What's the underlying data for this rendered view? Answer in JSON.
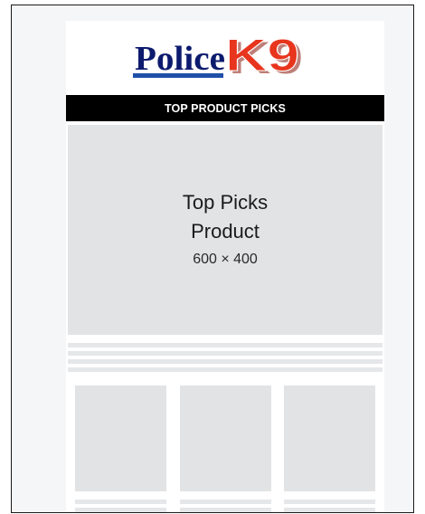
{
  "logo": {
    "text_police": "Police",
    "text_k9": "K9",
    "colors": {
      "police": "#0d1b6e",
      "k9": "#e8351e",
      "underline": "#1f4fa8"
    }
  },
  "banner": {
    "title": "TOP PRODUCT PICKS"
  },
  "hero": {
    "line1": "Top Picks",
    "line2": "Product",
    "size": "600 × 400"
  },
  "placeholders": {
    "text_lines": 4,
    "cards": 3
  },
  "colors": {
    "placeholder_bg": "#e2e3e5",
    "banner_bg": "#000000",
    "frame_bg": "#f5f6f8"
  }
}
